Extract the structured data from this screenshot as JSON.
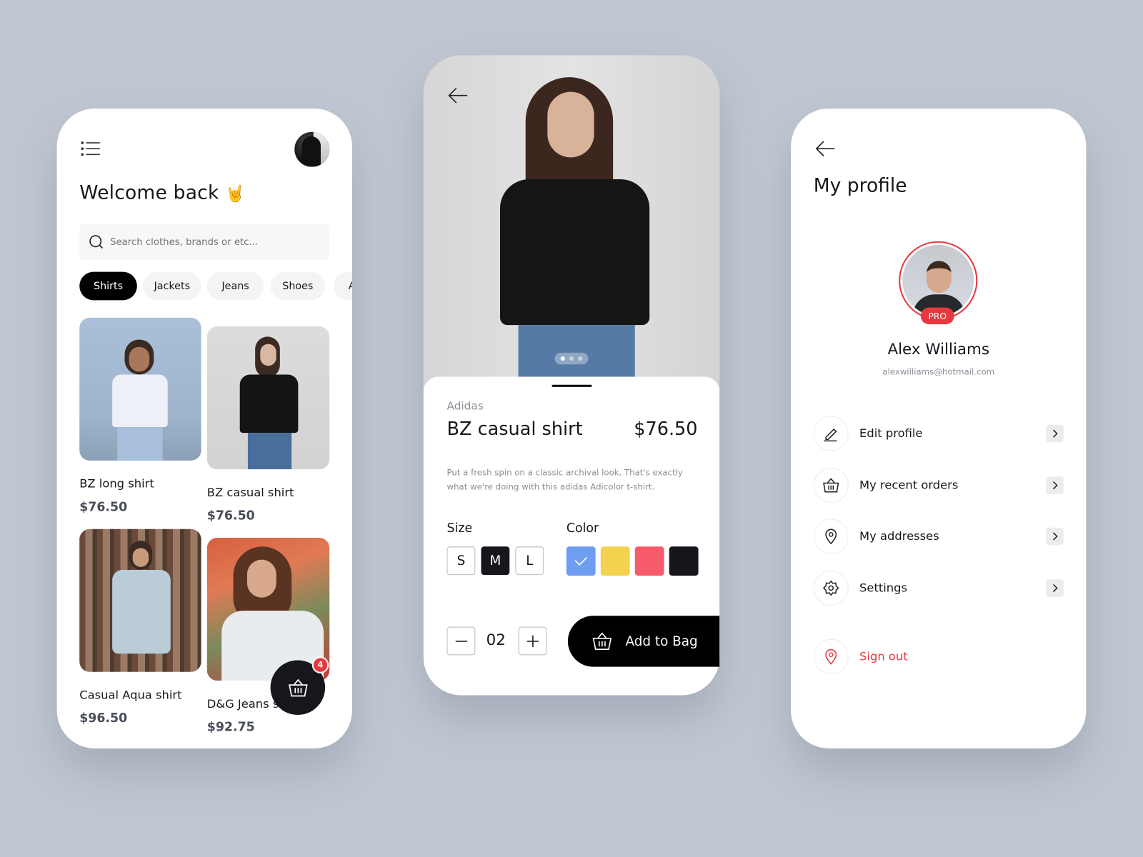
{
  "home": {
    "greeting": "Welcome back",
    "greeting_emoji": "🤘",
    "search_placeholder": "Search clothes, brands or etc...",
    "categories": [
      "Shirts",
      "Jackets",
      "Jeans",
      "Shoes",
      "A"
    ],
    "active_category": "Shirts",
    "products": [
      {
        "name": "BZ long shirt",
        "price": "$76.50"
      },
      {
        "name": "BZ casual shirt",
        "price": "$76.50"
      },
      {
        "name": "Casual Aqua shirt",
        "price": "$96.50"
      },
      {
        "name": "D&G Jeans shirt",
        "price": "$92.75"
      }
    ],
    "cart_count": "4"
  },
  "detail": {
    "brand": "Adidas",
    "title": "BZ casual shirt",
    "price": "$76.50",
    "description": "Put a fresh spin on a classic archival look. That's exactly what we're doing with this adidas Adicolor t-shirt.",
    "size_label": "Size",
    "sizes": [
      "S",
      "M",
      "L"
    ],
    "selected_size": "M",
    "color_label": "Color",
    "colors": [
      "#6f9ef0",
      "#f3d250",
      "#f55b6b",
      "#15161b"
    ],
    "selected_color": "#6f9ef0",
    "quantity": "02",
    "add_to_bag_label": "Add to Bag",
    "image_pages": 3,
    "image_current_page": 1
  },
  "profile": {
    "title": "My profile",
    "badge": "PRO",
    "name": "Alex Williams",
    "email": "alexwilliams@hotmail.com",
    "menu": [
      {
        "label": "Edit profile",
        "icon": "pencil-icon"
      },
      {
        "label": "My recent orders",
        "icon": "basket-icon"
      },
      {
        "label": "My addresses",
        "icon": "location-pin-icon"
      },
      {
        "label": "Settings",
        "icon": "gear-icon"
      }
    ],
    "sign_out_label": "Sign out",
    "accent": "#e5393f"
  }
}
